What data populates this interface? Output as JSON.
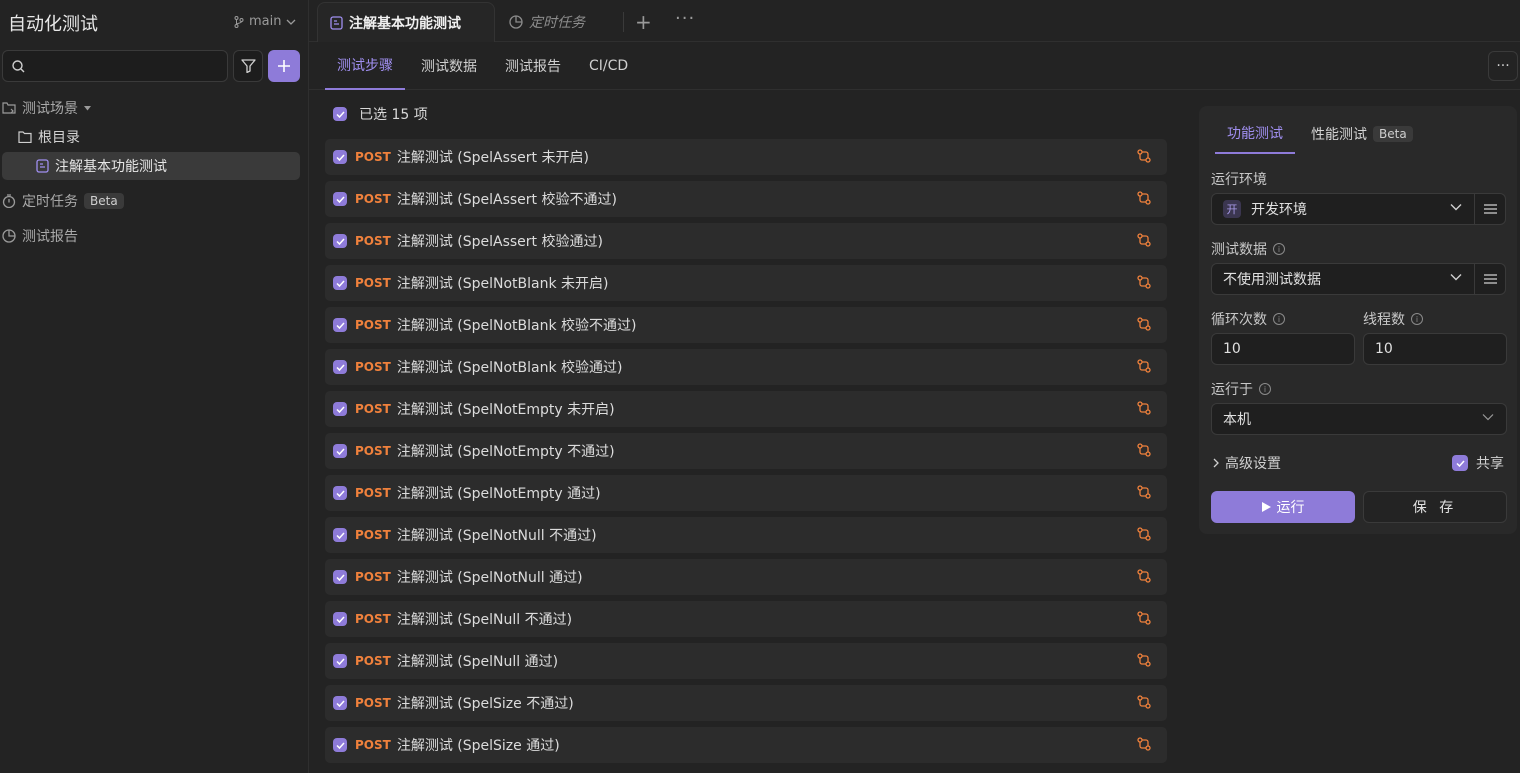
{
  "app": {
    "title": "自动化测试",
    "branch": "main"
  },
  "sidebar": {
    "search_placeholder": "",
    "scenes_label": "测试场景",
    "root_label": "根目录",
    "active_item": "注解基本功能测试",
    "schedule_label": "定时任务",
    "schedule_badge": "Beta",
    "report_label": "测试报告"
  },
  "tabs": {
    "active": "注解基本功能测试",
    "second": "定时任务"
  },
  "subtabs": [
    "测试步骤",
    "测试数据",
    "测试报告",
    "CI/CD"
  ],
  "selection": {
    "text": "已选 15 项"
  },
  "steps": [
    {
      "method": "POST",
      "name": "注解测试 (SpelAssert 未开启)"
    },
    {
      "method": "POST",
      "name": "注解测试 (SpelAssert 校验不通过)"
    },
    {
      "method": "POST",
      "name": "注解测试 (SpelAssert 校验通过)"
    },
    {
      "method": "POST",
      "name": "注解测试 (SpelNotBlank 未开启)"
    },
    {
      "method": "POST",
      "name": "注解测试 (SpelNotBlank 校验不通过)"
    },
    {
      "method": "POST",
      "name": "注解测试 (SpelNotBlank 校验通过)"
    },
    {
      "method": "POST",
      "name": "注解测试 (SpelNotEmpty 未开启)"
    },
    {
      "method": "POST",
      "name": "注解测试 (SpelNotEmpty 不通过)"
    },
    {
      "method": "POST",
      "name": "注解测试 (SpelNotEmpty 通过)"
    },
    {
      "method": "POST",
      "name": "注解测试 (SpelNotNull 不通过)"
    },
    {
      "method": "POST",
      "name": "注解测试 (SpelNotNull 通过)"
    },
    {
      "method": "POST",
      "name": "注解测试 (SpelNull 不通过)"
    },
    {
      "method": "POST",
      "name": "注解测试 (SpelNull 通过)"
    },
    {
      "method": "POST",
      "name": "注解测试 (SpelSize 不通过)"
    },
    {
      "method": "POST",
      "name": "注解测试 (SpelSize 通过)"
    }
  ],
  "panel": {
    "tab_functional": "功能测试",
    "tab_performance": "性能测试",
    "tab_performance_badge": "Beta",
    "env_label": "运行环境",
    "env_chip": "开",
    "env_value": "开发环境",
    "data_label": "测试数据",
    "data_value": "不使用测试数据",
    "loops_label": "循环次数",
    "loops_value": "10",
    "threads_label": "线程数",
    "threads_value": "10",
    "runon_label": "运行于",
    "runon_value": "本机",
    "advanced_label": "高级设置",
    "share_label": "共享",
    "run_label": "运行",
    "save_label": "保 存"
  },
  "colors": {
    "accent": "#8e7bd9",
    "method_post": "#f0813c",
    "background": "#232323"
  }
}
